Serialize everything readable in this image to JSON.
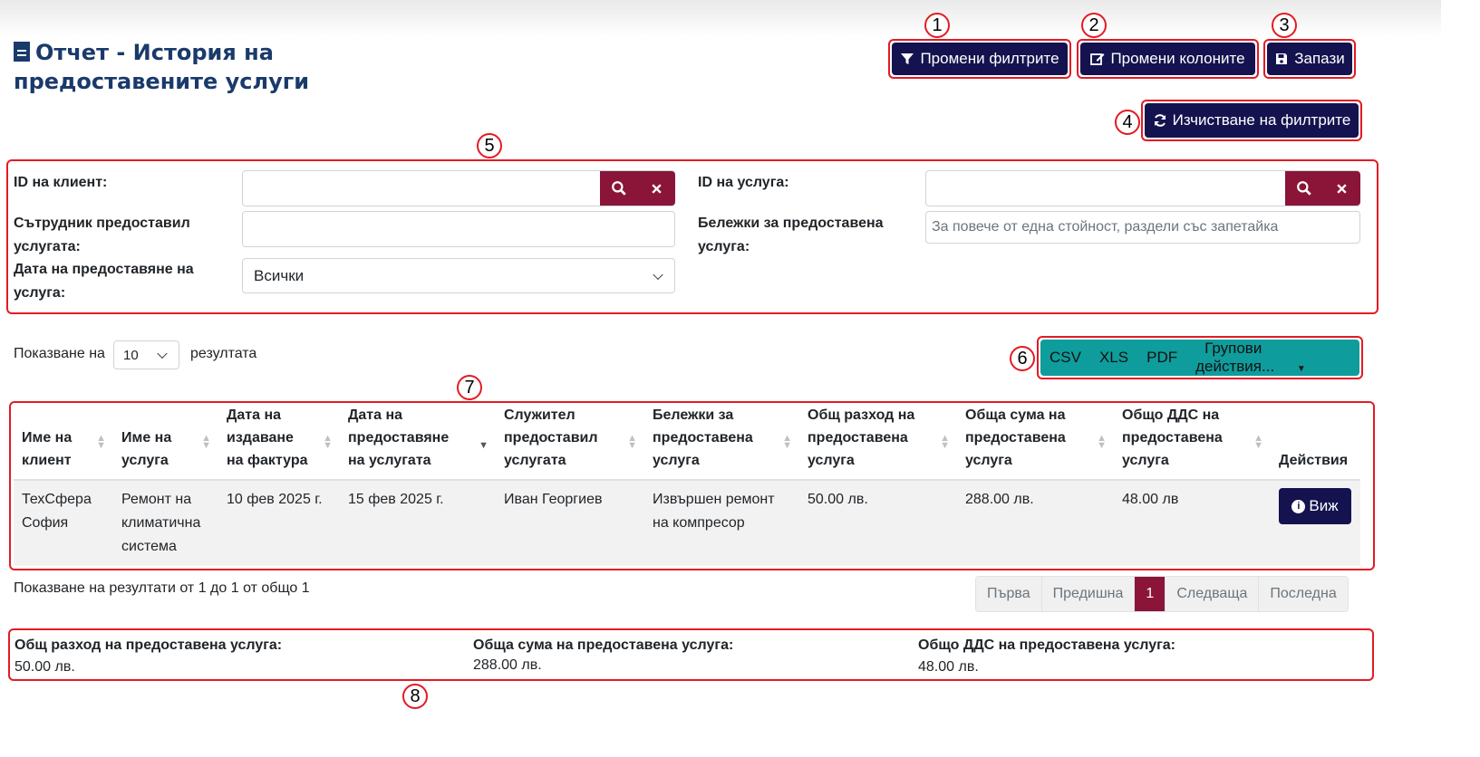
{
  "page": {
    "title_line1": "Отчет - История на",
    "title_line2": "предоставените услуги"
  },
  "toolbar": {
    "change_filters": "Промени филтрите",
    "change_columns": "Промени колоните",
    "save": "Запази",
    "clear_filters": "Изчистване на филтрите"
  },
  "callouts": [
    "1",
    "2",
    "3",
    "4",
    "5",
    "6",
    "7",
    "8"
  ],
  "filters": {
    "client_id_label": "ID на клиент:",
    "service_id_label": "ID на услуга:",
    "employee_label_1": "Сътрудник предоставил",
    "employee_label_2": "услугата:",
    "notes_label_1": "Бележки за предоставена",
    "notes_label_2": "услуга:",
    "notes_placeholder": "За повече от една стойност, раздели със запетайка",
    "date_label_1": "Дата на предоставяне на",
    "date_label_2": "услуга:",
    "date_value": "Всички"
  },
  "paging": {
    "show_prefix": "Показване на",
    "page_size": "10",
    "show_suffix": "резултата",
    "summary": "Показване на резултати от 1 до 1 от общо 1",
    "first": "Първа",
    "prev": "Предишна",
    "current": "1",
    "next": "Следваща",
    "last": "Последна"
  },
  "export": {
    "csv": "CSV",
    "xls": "XLS",
    "pdf": "PDF",
    "bulk": "Групови действия..."
  },
  "table": {
    "headers": [
      [
        "Име на",
        "клиент"
      ],
      [
        "Име на",
        "услуга"
      ],
      [
        "Дата на",
        "издаване",
        "на фактура"
      ],
      [
        "Дата на",
        "предоставяне",
        "на услугата"
      ],
      [
        "Служител",
        "предоставил",
        "услугата"
      ],
      [
        "Бележки за",
        "предоставена",
        "услуга"
      ],
      [
        "Общ разход на",
        "предоставена",
        "услуга"
      ],
      [
        "Обща сума на",
        "предоставена",
        "услуга"
      ],
      [
        "Общо ДДС на",
        "предоставена",
        "услуга"
      ],
      [
        "Действия"
      ]
    ],
    "row": {
      "client": [
        "ТехСфера",
        "София"
      ],
      "service": [
        "Ремонт на",
        "климатична",
        "система"
      ],
      "invoice_date": "10 фев 2025 г.",
      "service_date": "15 фев 2025 г.",
      "employee": "Иван Георгиев",
      "notes": [
        "Извършен ремонт",
        "на компресор"
      ],
      "cost": "50.00 лв.",
      "total": "288.00 лв.",
      "vat": "48.00 лв",
      "view": "Виж"
    }
  },
  "totals": {
    "cost_label": "Общ разход на предоставена услуга:",
    "cost_value": "50.00 лв.",
    "total_label": "Обща сума на предоставена услуга:",
    "total_value": "288.00 лв.",
    "vat_label": "Общо ДДС на предоставена услуга:",
    "vat_value": "48.00 лв."
  },
  "colors": {
    "primary_dark": "#14134f",
    "accent_maroon": "#8a1538",
    "export_teal": "#0f9c9c",
    "annotation_red": "#e31b23",
    "title_blue": "#1a3a6b"
  }
}
